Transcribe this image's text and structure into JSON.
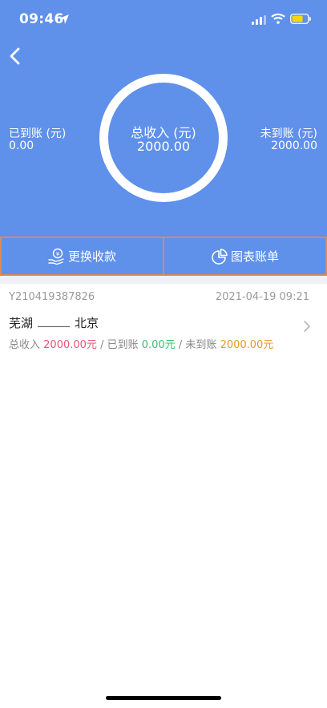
{
  "status_bar": {
    "time": "09:46"
  },
  "summary": {
    "received_label": "已到账 (元)",
    "received_value": "0.00",
    "total_label": "总收入 (元)",
    "total_value": "2000.00",
    "pending_label": "未到账 (元)",
    "pending_value": "2000.00"
  },
  "actions": {
    "change_payment_label": "更换收款",
    "chart_bill_label": "图表账单"
  },
  "records": [
    {
      "id": "Y210419387826",
      "datetime": "2021-04-19 09:21",
      "from": "芜湖",
      "to": "北京",
      "total_label": "总收入",
      "total_amount": "2000.00",
      "unit": "元",
      "sep": "/",
      "received_label": "已到账",
      "received_amount": "0.00",
      "pending_label": "未到账",
      "pending_amount": "2000.00"
    }
  ],
  "colors": {
    "header_bg": "#5f90ea",
    "button_border": "#dd8a55",
    "total_amount": "#e8537a",
    "received_amount": "#3cbf6e",
    "pending_amount": "#e69a2e"
  },
  "icons": [
    "location-arrow-icon",
    "signal-icon",
    "wifi-icon",
    "battery-icon",
    "back-arrow-icon",
    "hand-coin-icon",
    "pie-chart-icon",
    "chevron-right-icon"
  ]
}
